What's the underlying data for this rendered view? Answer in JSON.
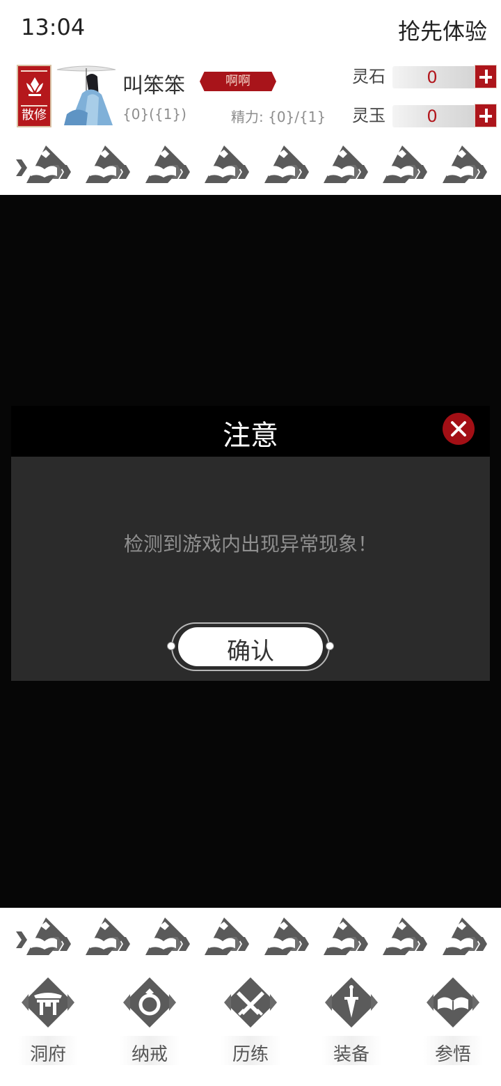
{
  "status_bar": {
    "time": "13:04",
    "title": "抢先体验"
  },
  "player": {
    "sect_label": "散修",
    "name": "叫笨笨",
    "title_badge": "啊啊",
    "level_text": "{0}({1})",
    "energy_text": "精力: {0}/{1}"
  },
  "resources": [
    {
      "label": "灵石",
      "value": "0"
    },
    {
      "label": "灵玉",
      "value": "0"
    }
  ],
  "dialog": {
    "title": "注意",
    "message": "检测到游戏内出现异常现象！",
    "confirm_label": "确认"
  },
  "nav": [
    {
      "label": "洞府",
      "icon": "gate-icon"
    },
    {
      "label": "纳戒",
      "icon": "ring-icon"
    },
    {
      "label": "历练",
      "icon": "crossed-swords-icon"
    },
    {
      "label": "装备",
      "icon": "dagger-icon"
    },
    {
      "label": "参悟",
      "icon": "book-icon"
    }
  ],
  "colors": {
    "accent_red": "#a8141a",
    "dialog_body": "#2b2b2b",
    "overlay": "#060606"
  }
}
